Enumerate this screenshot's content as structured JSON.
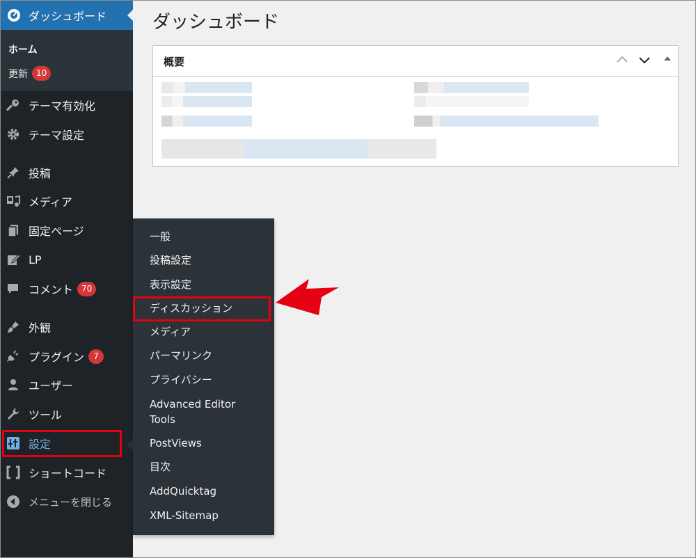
{
  "sidebar": {
    "dashboard_label": "ダッシュボード",
    "home_label": "ホーム",
    "update_label": "更新",
    "update_count": "10",
    "items": [
      {
        "label": "テーマ有効化",
        "icon": "key-icon"
      },
      {
        "label": "テーマ設定",
        "icon": "gear-icon"
      },
      {
        "label": "投稿",
        "icon": "pin-icon"
      },
      {
        "label": "メディア",
        "icon": "media-icon"
      },
      {
        "label": "固定ページ",
        "icon": "pages-icon"
      },
      {
        "label": "LP",
        "icon": "edit-icon"
      },
      {
        "label": "コメント",
        "icon": "comment-icon",
        "badge": "70"
      },
      {
        "label": "外観",
        "icon": "brush-icon"
      },
      {
        "label": "プラグイン",
        "icon": "plugin-icon",
        "badge": "7"
      },
      {
        "label": "ユーザー",
        "icon": "user-icon"
      },
      {
        "label": "ツール",
        "icon": "wrench-icon"
      },
      {
        "label": "設定",
        "icon": "settings-icon",
        "active": true
      },
      {
        "label": "ショートコード",
        "icon": "brackets-icon"
      },
      {
        "label": "メニューを閉じる",
        "icon": "collapse-icon"
      }
    ]
  },
  "flyout": {
    "items": [
      "一般",
      "投稿設定",
      "表示設定",
      "ディスカッション",
      "メディア",
      "パーマリンク",
      "プライバシー",
      "Advanced Editor Tools",
      "PostViews",
      "目次",
      "AddQuicktag",
      "XML-Sitemap"
    ]
  },
  "main": {
    "title": "ダッシュボード",
    "panel_title": "概要"
  },
  "colors": {
    "sidebar_bg": "#1d2327",
    "active_blue": "#2271b1",
    "highlight_red": "#e50012",
    "badge_red": "#d63638"
  }
}
